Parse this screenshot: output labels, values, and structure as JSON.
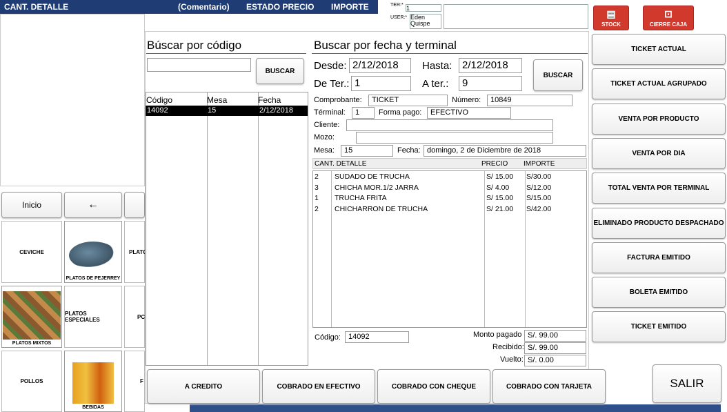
{
  "header": {
    "cols": [
      "CANT. DETALLE",
      "(Comentario)",
      "ESTADO PRECIO",
      "IMPORTE"
    ],
    "ter_label": "TER:*",
    "ter_value": "1",
    "user_label": "USER:*",
    "user_value": "Eden Quispe",
    "stock": "STOCK",
    "cierre": "CIERRE CAJA"
  },
  "left": {
    "inicio": "Inicio",
    "back": "←",
    "cats": [
      {
        "label": "CEVICHE"
      },
      {
        "label": "PLATOS DE PEJERREY"
      },
      {
        "label": "PLATC"
      },
      {
        "label": "PLATOS MIXTOS"
      },
      {
        "label": "PLATOS ESPECIALES"
      },
      {
        "label": "PC"
      },
      {
        "label": "POLLOS"
      },
      {
        "label": "BEBIDAS"
      },
      {
        "label": "F"
      }
    ]
  },
  "code_search": {
    "title": "Búscar por código",
    "button": "BUSCAR",
    "input": "",
    "headers": [
      "Código",
      "Mesa",
      "Fecha"
    ],
    "rows": [
      [
        "14092",
        "15",
        "2/12/2018"
      ]
    ]
  },
  "date_search": {
    "title": "Buscar por fecha y terminal",
    "desde_label": "Desde:",
    "desde": "2/12/2018",
    "hasta_label": "Hasta:",
    "hasta": "2/12/2018",
    "deter_label": "De Ter.:",
    "deter": "1",
    "ater_label": "A ter.:",
    "ater": "9",
    "button": "BUSCAR"
  },
  "ticket": {
    "comprobante_label": "Comprobante:",
    "comprobante": "TICKET",
    "numero_label": "Número:",
    "numero": "10849",
    "terminal_label": "Términal:",
    "terminal": "1",
    "forma_label": "Forma pago:",
    "forma": "EFECTIVO",
    "cliente_label": "Cliente:",
    "cliente": "",
    "mozo_label": "Mozo:",
    "mozo": "",
    "mesa_label": "Mesa:",
    "mesa": "15",
    "fecha_label": "Fecha:",
    "fecha": "domingo, 2 de Diciembre de 2018",
    "headers": [
      "CANT. DETALLE",
      "PRECIO",
      "IMPORTE"
    ],
    "items": [
      [
        "2",
        "SUDADO DE TRUCHA",
        "S/ 15.00",
        "S/30.00"
      ],
      [
        "3",
        "CHICHA MOR.1/2 JARRA",
        "S/ 4.00",
        "S/12.00"
      ],
      [
        "1",
        "TRUCHA FRITA",
        "S/ 15.00",
        "S/15.00"
      ],
      [
        "2",
        "CHICHARRON DE TRUCHA",
        "S/ 21.00",
        "S/42.00"
      ]
    ],
    "codigo_label": "Código:",
    "codigo": "14092",
    "monto_label": "Monto pagado",
    "monto": "S/. 99.00",
    "recibido_label": "Recibido:",
    "recibido": "S/. 99.00",
    "vuelto_label": "Vuelto:",
    "vuelto": "S/. 0.00"
  },
  "reports": [
    "TICKET ACTUAL",
    "TICKET ACTUAL AGRUPADO",
    "VENTA POR PRODUCTO",
    "VENTA POR DIA",
    "TOTAL VENTA POR TERMINAL",
    "ELIMINADO PRODUCTO DESPACHADO",
    "FACTURA EMITIDO",
    "BOLETA EMITIDO",
    "TICKET EMITIDO"
  ],
  "bottom": {
    "credito": "A CREDITO",
    "efectivo": "COBRADO EN EFECTIVO",
    "cheque": "COBRADO CON CHEQUE",
    "tarjeta": "COBRADO CON TARJETA",
    "salir": "SALIR"
  },
  "colors": {
    "header_bg": "#1f3d74",
    "red": "#d0392b",
    "select_bg": "#000000"
  }
}
